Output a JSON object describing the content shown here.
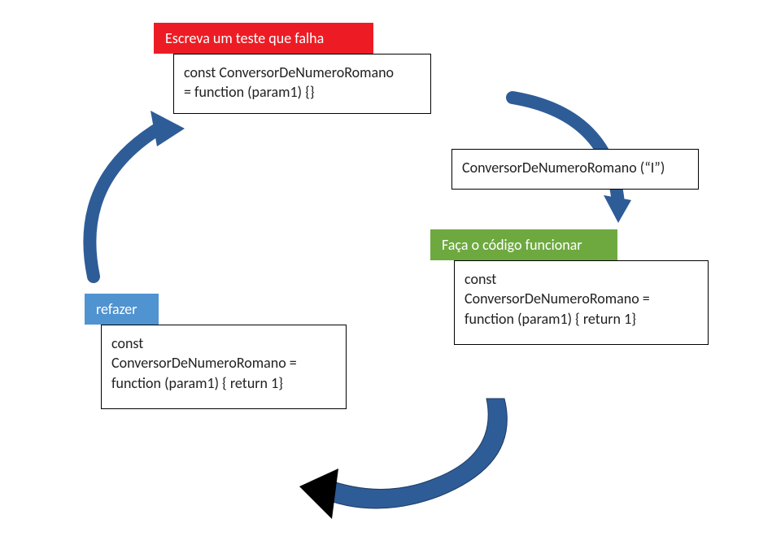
{
  "redLabel": "Escreva um teste que falha",
  "greenLabel": "Faça o código funcionar",
  "blueLabel": "refazer",
  "codeTop1": "const ConversorDeNumeroRomano",
  "codeTop2": "= function (param1) {}",
  "codeRight": "ConversorDeNumeroRomano (“I”)",
  "codeGreen1": "const",
  "codeGreen2": "ConversorDeNumeroRomano =",
  "codeGreen3": "function (param1) { return 1}",
  "codeBlue1": "const",
  "codeBlue2": "ConversorDeNumeroRomano =",
  "codeBlue3": "function (param1) { return 1}"
}
